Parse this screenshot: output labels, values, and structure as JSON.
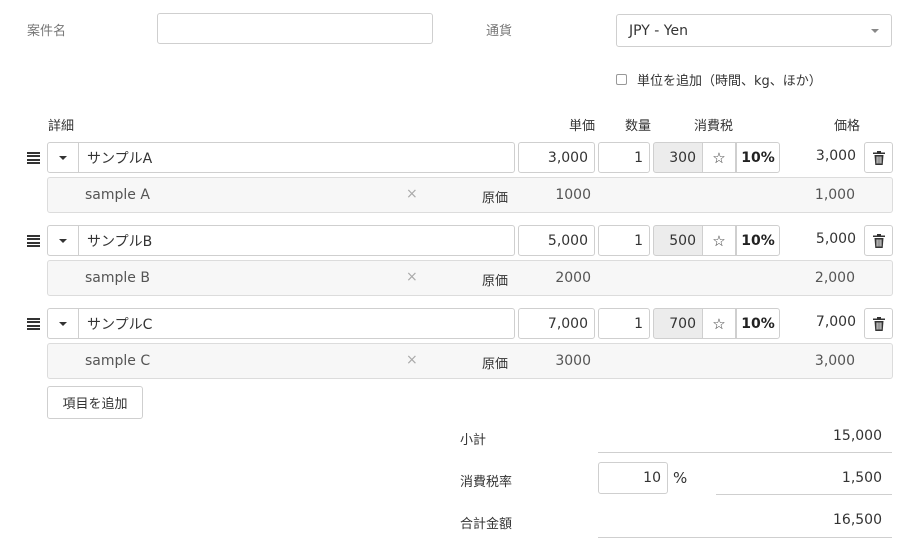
{
  "header": {
    "project_label": "案件名",
    "project_value": "",
    "currency_label": "通貨",
    "currency_selected": "JPY - Yen",
    "unit_checkbox_label": "単位を追加（時間、kg、ほか）",
    "unit_checkbox_checked": false
  },
  "columns": {
    "detail": "詳細",
    "unit_price": "単価",
    "quantity": "数量",
    "tax": "消費税",
    "price": "価格"
  },
  "items": [
    {
      "name": "サンプルA",
      "unit_price": "3,000",
      "quantity": "1",
      "tax": "300",
      "tax_icon": "☆",
      "tax_rate": "10%",
      "price": "3,000",
      "description": "sample A",
      "cost_label": "原価",
      "cost": "1000",
      "cost_total": "1,000"
    },
    {
      "name": "サンプルB",
      "unit_price": "5,000",
      "quantity": "1",
      "tax": "500",
      "tax_icon": "☆",
      "tax_rate": "10%",
      "price": "5,000",
      "description": "sample B",
      "cost_label": "原価",
      "cost": "2000",
      "cost_total": "2,000"
    },
    {
      "name": "サンプルC",
      "unit_price": "7,000",
      "quantity": "1",
      "tax": "700",
      "tax_icon": "☆",
      "tax_rate": "10%",
      "price": "7,000",
      "description": "sample C",
      "cost_label": "原価",
      "cost": "3000",
      "cost_total": "3,000"
    }
  ],
  "add_item_label": "項目を追加",
  "summary": {
    "subtotal_label": "小計",
    "subtotal_value": "15,000",
    "tax_rate_label": "消費税率",
    "tax_rate_input": "10",
    "tax_rate_unit": "%",
    "tax_value": "1,500",
    "total_label": "合計金額",
    "total_value": "16,500"
  },
  "icons": {
    "remove": "×"
  }
}
